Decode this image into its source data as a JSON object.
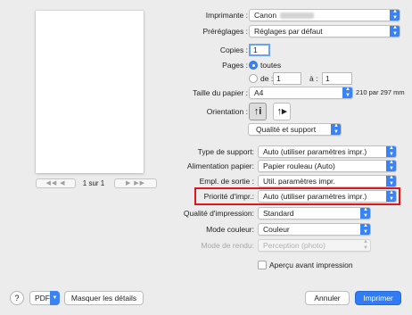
{
  "preview": {
    "page_indicator": "1 sur 1",
    "first_page_glyph": "◀◀",
    "prev_page_glyph": "◀",
    "next_page_glyph": "▶",
    "last_page_glyph": "▶▶"
  },
  "printer": {
    "label": "Imprimante :",
    "value": "Canon"
  },
  "presets": {
    "label": "Préréglages :",
    "value": "Réglages par défaut"
  },
  "copies": {
    "label": "Copies :",
    "value": "1"
  },
  "pages": {
    "label": "Pages :",
    "all_label": "toutes",
    "from_label": "de :",
    "from_value": "1",
    "to_label": "à :",
    "to_value": "1"
  },
  "paper_size": {
    "label": "Taille du papier :",
    "value": "A4",
    "dims": "210 par 297 mm"
  },
  "orientation": {
    "label": "Orientation :",
    "portrait_glyph": "↑i",
    "landscape_glyph": "↑▸"
  },
  "section": {
    "value": "Qualité et support"
  },
  "support_type": {
    "label": "Type de support:",
    "value": "Auto (utiliser paramètres impr.)"
  },
  "paper_feed": {
    "label": "Alimentation papier:",
    "value": "Papier rouleau (Auto)"
  },
  "output_slot": {
    "label": "Empl. de sortie :",
    "value": "Util. paramètres impr."
  },
  "priority": {
    "label": "Priorité d'impr.:",
    "value": "Auto (utiliser paramètres impr.)"
  },
  "print_quality": {
    "label": "Qualité d'impression:",
    "value": "Standard"
  },
  "color_mode": {
    "label": "Mode couleur:",
    "value": "Couleur"
  },
  "render_mode": {
    "label": "Mode de rendu:",
    "value": "Perception (photo)"
  },
  "preview_checkbox": {
    "label": "Aperçu avant impression"
  },
  "footer": {
    "help_glyph": "?",
    "pdf_label": "PDF",
    "hide_details_label": "Masquer les détails",
    "cancel_label": "Annuler",
    "print_label": "Imprimer"
  },
  "colors": {
    "accent": "#3a83f4",
    "highlight_box": "#e0161d"
  }
}
